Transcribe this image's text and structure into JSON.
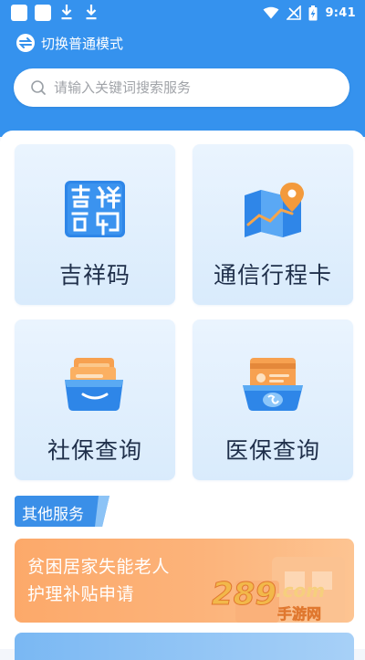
{
  "status_bar": {
    "time": "9:41"
  },
  "header": {
    "mode_switch_label": "切换普通模式",
    "search_placeholder": "请输入关键词搜索服务"
  },
  "services": [
    {
      "label": "吉祥码",
      "icon": "jixiang-code-icon"
    },
    {
      "label": "通信行程卡",
      "icon": "travel-map-icon"
    },
    {
      "label": "社保查询",
      "icon": "social-security-box-icon"
    },
    {
      "label": "医保查询",
      "icon": "medical-insurance-card-icon"
    }
  ],
  "other_services": {
    "title": "其他服务",
    "banner_line1": "贫困居家失能老人",
    "banner_line2": "护理补贴申请"
  },
  "watermark": {
    "main": "289",
    "suffix": ".com",
    "sub": "手游网"
  },
  "colors": {
    "primary": "#3592ee",
    "accent_orange": "#fca96a",
    "card_bg": "#e4f1fd"
  }
}
